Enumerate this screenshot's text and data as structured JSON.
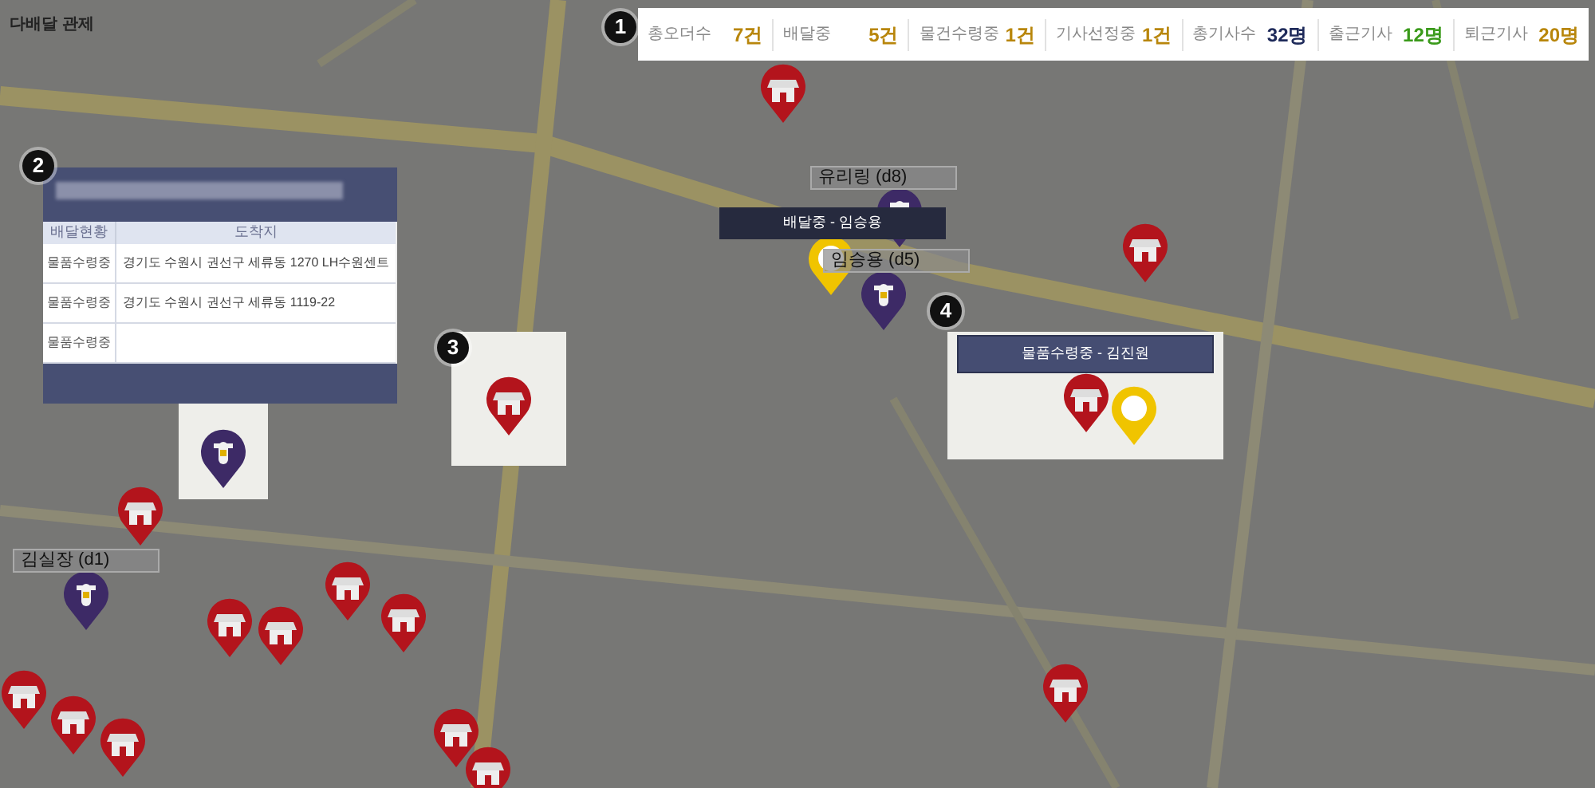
{
  "header": {
    "title": "다배달 관제"
  },
  "stats": [
    {
      "label": "총오더수",
      "value": "7건",
      "color": "#b8860b"
    },
    {
      "label": "배달중",
      "value": "5건",
      "color": "#b8860b"
    },
    {
      "label": "물건수령중",
      "value": "1건",
      "color": "#b8860b"
    },
    {
      "label": "기사선정중",
      "value": "1건",
      "color": "#b8860b"
    },
    {
      "label": "총기사수",
      "value": "32명",
      "color": "#1e2a5a"
    },
    {
      "label": "출근기사",
      "value": "12명",
      "color": "#3a9a1a"
    },
    {
      "label": "퇴근기사",
      "value": "20명",
      "color": "#b8860b"
    }
  ],
  "callouts": [
    "1",
    "2",
    "3",
    "4"
  ],
  "order_panel": {
    "columns": [
      "배달현황",
      "도착지"
    ],
    "rows": [
      {
        "status": "물품수령중",
        "destination": "경기도 수원시 권선구 세류동 1270 LH수원센트"
      },
      {
        "status": "물품수령중",
        "destination": "경기도 수원시 권선구 세류동 1119-22"
      },
      {
        "status": "물품수령중",
        "destination": ""
      }
    ]
  },
  "map_pins": [
    {
      "kind": "store"
    },
    {
      "kind": "store"
    },
    {
      "kind": "store"
    },
    {
      "kind": "store"
    },
    {
      "kind": "store"
    },
    {
      "kind": "store"
    },
    {
      "kind": "store"
    },
    {
      "kind": "store"
    },
    {
      "kind": "store"
    },
    {
      "kind": "store"
    },
    {
      "kind": "store"
    },
    {
      "kind": "store"
    },
    {
      "kind": "store"
    },
    {
      "kind": "rider"
    },
    {
      "kind": "rider"
    },
    {
      "kind": "rider"
    },
    {
      "kind": "pickup"
    }
  ],
  "map_labels": [
    {
      "kind": "name",
      "text": "유리링 (d8)"
    },
    {
      "kind": "status",
      "text": "배달중 - 임승용"
    },
    {
      "kind": "name",
      "text": "임승용 (d5)"
    },
    {
      "kind": "name",
      "text": "김실장 (d1)"
    }
  ],
  "insets": [
    {
      "pins": [
        {
          "kind": "rider"
        }
      ]
    },
    {
      "pins": [
        {
          "kind": "store"
        }
      ]
    },
    {
      "status": "물품수령중 - 김진원",
      "pins": [
        {
          "kind": "store"
        },
        {
          "kind": "pickup"
        }
      ]
    }
  ]
}
